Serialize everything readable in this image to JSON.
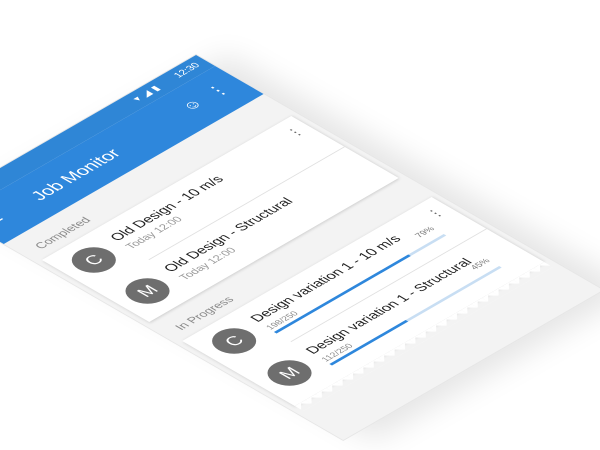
{
  "status_bar": {
    "time": "12:30"
  },
  "app_bar": {
    "title": "Job Monitor"
  },
  "completed": {
    "section_label": "Completed",
    "jobs": [
      {
        "avatar": "C",
        "title": "Old Design - 10 m/s",
        "subtitle": "Today 12:00"
      },
      {
        "avatar": "M",
        "title": "Old Design - Structural",
        "subtitle": "Today 12:00"
      }
    ]
  },
  "in_progress": {
    "section_label": "In Progress",
    "jobs": [
      {
        "avatar": "C",
        "title": "Design variation 1 - 10 m/s",
        "count": "198/250",
        "percent": "79%",
        "progress": 0.79
      },
      {
        "avatar": "M",
        "title": "Design variation 1 - Structural",
        "count": "112/250",
        "percent": "45%",
        "progress": 0.45
      }
    ]
  },
  "colors": {
    "primary": "#2e87dc",
    "progress_track": "#c8def3",
    "avatar": "#6e6e6e"
  }
}
